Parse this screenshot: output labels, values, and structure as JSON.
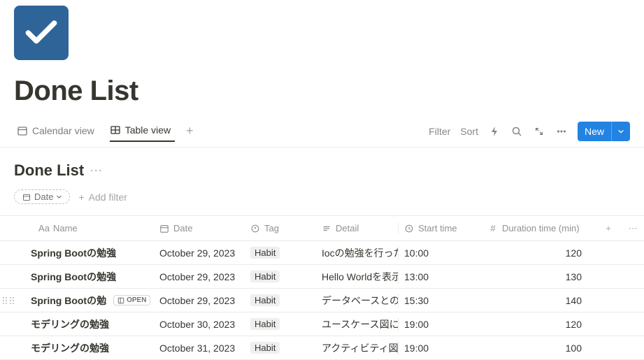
{
  "page": {
    "title": "Done List"
  },
  "tabs": {
    "calendar": "Calendar view",
    "table": "Table view"
  },
  "toolbar": {
    "filter": "Filter",
    "sort": "Sort",
    "new": "New"
  },
  "subhead": {
    "title": "Done List"
  },
  "filters": {
    "date_chip": "Date",
    "add_filter": "Add filter"
  },
  "columns": {
    "name": "Name",
    "date": "Date",
    "tag": "Tag",
    "detail": "Detail",
    "start": "Start time",
    "duration": "Duration time (min)"
  },
  "open_label": "OPEN",
  "rows": [
    {
      "name": "Spring Bootの勉強",
      "date": "October 29, 2023",
      "tag": "Habit",
      "detail": "Iocの勉強を行った",
      "start": "10:00",
      "duration": "120",
      "hover": false
    },
    {
      "name": "Spring Bootの勉強",
      "date": "October 29, 2023",
      "tag": "Habit",
      "detail": "Hello Worldを表示",
      "start": "13:00",
      "duration": "130",
      "hover": false
    },
    {
      "name": "Spring Bootの勉",
      "date": "October 29, 2023",
      "tag": "Habit",
      "detail": "データベースとの",
      "start": "15:30",
      "duration": "140",
      "hover": true
    },
    {
      "name": "モデリングの勉強",
      "date": "October 30, 2023",
      "tag": "Habit",
      "detail": "ユースケース図に",
      "start": "19:00",
      "duration": "120",
      "hover": false
    },
    {
      "name": "モデリングの勉強",
      "date": "October 31, 2023",
      "tag": "Habit",
      "detail": "アクティビティ図",
      "start": "19:00",
      "duration": "100",
      "hover": false
    }
  ]
}
